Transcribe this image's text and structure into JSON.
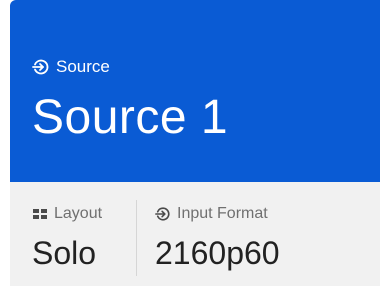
{
  "header": {
    "label": "Source",
    "label_icon": "input-arrow-icon",
    "title": "Source 1"
  },
  "footer": {
    "layout": {
      "label": "Layout",
      "icon": "grid-layout-icon",
      "value": "Solo"
    },
    "input_format": {
      "label": "Input Format",
      "icon": "input-arrow-icon",
      "value": "2160p60"
    }
  },
  "colors": {
    "header_bg": "#0a5bd4",
    "header_text": "#ffffff",
    "footer_bg": "#f1f1f1",
    "label_text": "#707070",
    "value_text": "#222222"
  }
}
